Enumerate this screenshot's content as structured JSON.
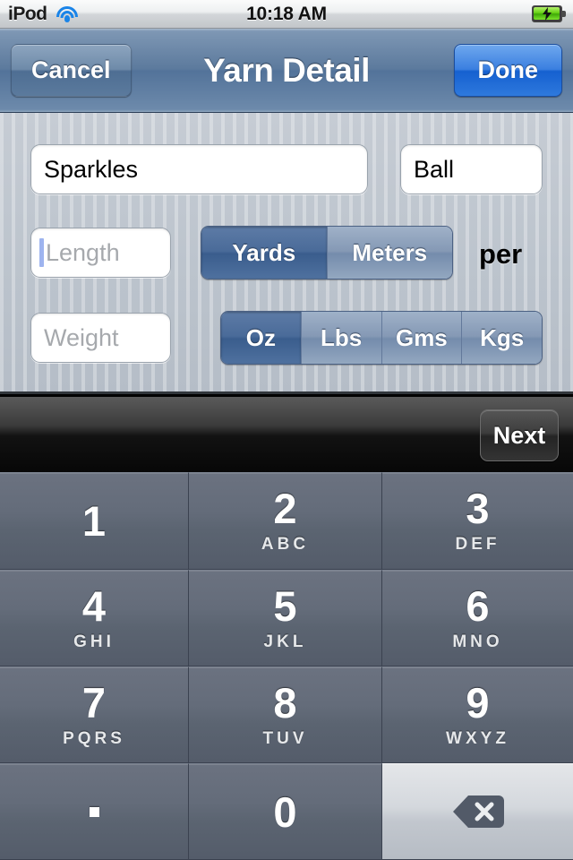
{
  "status_bar": {
    "carrier": "iPod",
    "wifi_icon": "wifi-icon",
    "time": "10:18 AM",
    "battery_icon": "battery-charging-icon"
  },
  "nav_bar": {
    "cancel_label": "Cancel",
    "title": "Yarn Detail",
    "done_label": "Done"
  },
  "form": {
    "name_field": {
      "value": "Sparkles",
      "placeholder": ""
    },
    "unit_field": {
      "value": "Ball",
      "placeholder": ""
    },
    "length_field": {
      "value": "",
      "placeholder": "Length"
    },
    "weight_field": {
      "value": "",
      "placeholder": "Weight"
    },
    "per_label": "per",
    "length_units": {
      "options": [
        "Yards",
        "Meters"
      ],
      "selected": "Yards"
    },
    "weight_units": {
      "options": [
        "Oz",
        "Lbs",
        "Gms",
        "Kgs"
      ],
      "selected": "Oz"
    }
  },
  "accessory_bar": {
    "next_label": "Next"
  },
  "keypad": {
    "keys": [
      {
        "num": "1",
        "sub": ""
      },
      {
        "num": "2",
        "sub": "ABC"
      },
      {
        "num": "3",
        "sub": "DEF"
      },
      {
        "num": "4",
        "sub": "GHI"
      },
      {
        "num": "5",
        "sub": "JKL"
      },
      {
        "num": "6",
        "sub": "MNO"
      },
      {
        "num": "7",
        "sub": "PQRS"
      },
      {
        "num": "8",
        "sub": "TUV"
      },
      {
        "num": "9",
        "sub": "WXYZ"
      },
      {
        "num": ".",
        "sub": ""
      },
      {
        "num": "0",
        "sub": ""
      },
      {
        "num": "",
        "sub": "",
        "icon": "backspace-icon"
      }
    ]
  },
  "colors": {
    "nav_bar": "#53739a",
    "done_button": "#1560d0",
    "segment_selected": "#3a5d8d",
    "segment_unselected": "#748cac",
    "keypad_key": "#5b6471",
    "backspace_key": "#c2c7ce",
    "panel_background": "#bcc4cd",
    "caret": "#9eb4ef",
    "battery_green": "#67d316",
    "wifi_blue": "#1a84e8"
  }
}
